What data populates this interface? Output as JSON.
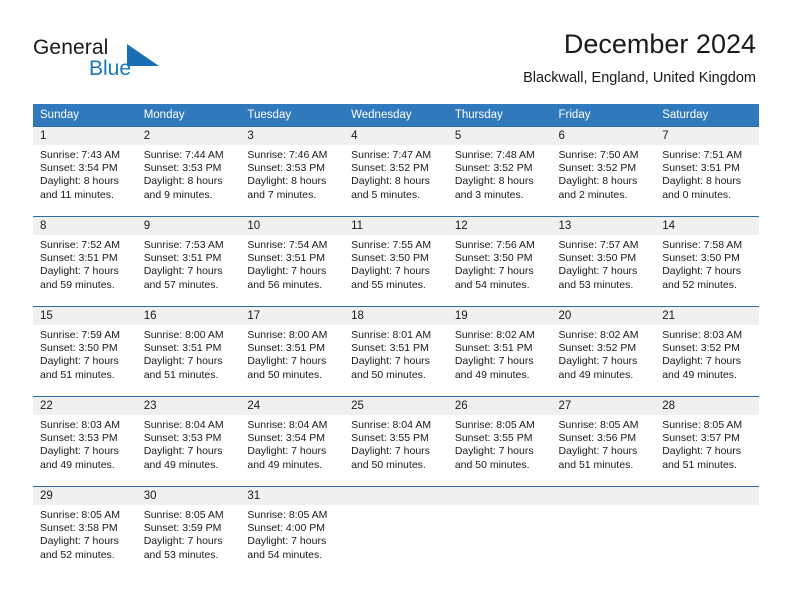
{
  "brand": {
    "name_part1": "General",
    "name_part2": "Blue",
    "logo_icon": "triangle-icon",
    "accent_color": "#1878be"
  },
  "header": {
    "title": "December 2024",
    "location": "Blackwall, England, United Kingdom"
  },
  "theme": {
    "header_bg": "#3179bd",
    "row_border": "#2e6da4",
    "daynum_bg": "#f0f0f0"
  },
  "weekday_headers": [
    "Sunday",
    "Monday",
    "Tuesday",
    "Wednesday",
    "Thursday",
    "Friday",
    "Saturday"
  ],
  "weeks": [
    [
      {
        "day": "1",
        "sunrise": "Sunrise: 7:43 AM",
        "sunset": "Sunset: 3:54 PM",
        "daylight_line1": "Daylight: 8 hours",
        "daylight_line2": "and 11 minutes."
      },
      {
        "day": "2",
        "sunrise": "Sunrise: 7:44 AM",
        "sunset": "Sunset: 3:53 PM",
        "daylight_line1": "Daylight: 8 hours",
        "daylight_line2": "and 9 minutes."
      },
      {
        "day": "3",
        "sunrise": "Sunrise: 7:46 AM",
        "sunset": "Sunset: 3:53 PM",
        "daylight_line1": "Daylight: 8 hours",
        "daylight_line2": "and 7 minutes."
      },
      {
        "day": "4",
        "sunrise": "Sunrise: 7:47 AM",
        "sunset": "Sunset: 3:52 PM",
        "daylight_line1": "Daylight: 8 hours",
        "daylight_line2": "and 5 minutes."
      },
      {
        "day": "5",
        "sunrise": "Sunrise: 7:48 AM",
        "sunset": "Sunset: 3:52 PM",
        "daylight_line1": "Daylight: 8 hours",
        "daylight_line2": "and 3 minutes."
      },
      {
        "day": "6",
        "sunrise": "Sunrise: 7:50 AM",
        "sunset": "Sunset: 3:52 PM",
        "daylight_line1": "Daylight: 8 hours",
        "daylight_line2": "and 2 minutes."
      },
      {
        "day": "7",
        "sunrise": "Sunrise: 7:51 AM",
        "sunset": "Sunset: 3:51 PM",
        "daylight_line1": "Daylight: 8 hours",
        "daylight_line2": "and 0 minutes."
      }
    ],
    [
      {
        "day": "8",
        "sunrise": "Sunrise: 7:52 AM",
        "sunset": "Sunset: 3:51 PM",
        "daylight_line1": "Daylight: 7 hours",
        "daylight_line2": "and 59 minutes."
      },
      {
        "day": "9",
        "sunrise": "Sunrise: 7:53 AM",
        "sunset": "Sunset: 3:51 PM",
        "daylight_line1": "Daylight: 7 hours",
        "daylight_line2": "and 57 minutes."
      },
      {
        "day": "10",
        "sunrise": "Sunrise: 7:54 AM",
        "sunset": "Sunset: 3:51 PM",
        "daylight_line1": "Daylight: 7 hours",
        "daylight_line2": "and 56 minutes."
      },
      {
        "day": "11",
        "sunrise": "Sunrise: 7:55 AM",
        "sunset": "Sunset: 3:50 PM",
        "daylight_line1": "Daylight: 7 hours",
        "daylight_line2": "and 55 minutes."
      },
      {
        "day": "12",
        "sunrise": "Sunrise: 7:56 AM",
        "sunset": "Sunset: 3:50 PM",
        "daylight_line1": "Daylight: 7 hours",
        "daylight_line2": "and 54 minutes."
      },
      {
        "day": "13",
        "sunrise": "Sunrise: 7:57 AM",
        "sunset": "Sunset: 3:50 PM",
        "daylight_line1": "Daylight: 7 hours",
        "daylight_line2": "and 53 minutes."
      },
      {
        "day": "14",
        "sunrise": "Sunrise: 7:58 AM",
        "sunset": "Sunset: 3:50 PM",
        "daylight_line1": "Daylight: 7 hours",
        "daylight_line2": "and 52 minutes."
      }
    ],
    [
      {
        "day": "15",
        "sunrise": "Sunrise: 7:59 AM",
        "sunset": "Sunset: 3:50 PM",
        "daylight_line1": "Daylight: 7 hours",
        "daylight_line2": "and 51 minutes."
      },
      {
        "day": "16",
        "sunrise": "Sunrise: 8:00 AM",
        "sunset": "Sunset: 3:51 PM",
        "daylight_line1": "Daylight: 7 hours",
        "daylight_line2": "and 51 minutes."
      },
      {
        "day": "17",
        "sunrise": "Sunrise: 8:00 AM",
        "sunset": "Sunset: 3:51 PM",
        "daylight_line1": "Daylight: 7 hours",
        "daylight_line2": "and 50 minutes."
      },
      {
        "day": "18",
        "sunrise": "Sunrise: 8:01 AM",
        "sunset": "Sunset: 3:51 PM",
        "daylight_line1": "Daylight: 7 hours",
        "daylight_line2": "and 50 minutes."
      },
      {
        "day": "19",
        "sunrise": "Sunrise: 8:02 AM",
        "sunset": "Sunset: 3:51 PM",
        "daylight_line1": "Daylight: 7 hours",
        "daylight_line2": "and 49 minutes."
      },
      {
        "day": "20",
        "sunrise": "Sunrise: 8:02 AM",
        "sunset": "Sunset: 3:52 PM",
        "daylight_line1": "Daylight: 7 hours",
        "daylight_line2": "and 49 minutes."
      },
      {
        "day": "21",
        "sunrise": "Sunrise: 8:03 AM",
        "sunset": "Sunset: 3:52 PM",
        "daylight_line1": "Daylight: 7 hours",
        "daylight_line2": "and 49 minutes."
      }
    ],
    [
      {
        "day": "22",
        "sunrise": "Sunrise: 8:03 AM",
        "sunset": "Sunset: 3:53 PM",
        "daylight_line1": "Daylight: 7 hours",
        "daylight_line2": "and 49 minutes."
      },
      {
        "day": "23",
        "sunrise": "Sunrise: 8:04 AM",
        "sunset": "Sunset: 3:53 PM",
        "daylight_line1": "Daylight: 7 hours",
        "daylight_line2": "and 49 minutes."
      },
      {
        "day": "24",
        "sunrise": "Sunrise: 8:04 AM",
        "sunset": "Sunset: 3:54 PM",
        "daylight_line1": "Daylight: 7 hours",
        "daylight_line2": "and 49 minutes."
      },
      {
        "day": "25",
        "sunrise": "Sunrise: 8:04 AM",
        "sunset": "Sunset: 3:55 PM",
        "daylight_line1": "Daylight: 7 hours",
        "daylight_line2": "and 50 minutes."
      },
      {
        "day": "26",
        "sunrise": "Sunrise: 8:05 AM",
        "sunset": "Sunset: 3:55 PM",
        "daylight_line1": "Daylight: 7 hours",
        "daylight_line2": "and 50 minutes."
      },
      {
        "day": "27",
        "sunrise": "Sunrise: 8:05 AM",
        "sunset": "Sunset: 3:56 PM",
        "daylight_line1": "Daylight: 7 hours",
        "daylight_line2": "and 51 minutes."
      },
      {
        "day": "28",
        "sunrise": "Sunrise: 8:05 AM",
        "sunset": "Sunset: 3:57 PM",
        "daylight_line1": "Daylight: 7 hours",
        "daylight_line2": "and 51 minutes."
      }
    ],
    [
      {
        "day": "29",
        "sunrise": "Sunrise: 8:05 AM",
        "sunset": "Sunset: 3:58 PM",
        "daylight_line1": "Daylight: 7 hours",
        "daylight_line2": "and 52 minutes."
      },
      {
        "day": "30",
        "sunrise": "Sunrise: 8:05 AM",
        "sunset": "Sunset: 3:59 PM",
        "daylight_line1": "Daylight: 7 hours",
        "daylight_line2": "and 53 minutes."
      },
      {
        "day": "31",
        "sunrise": "Sunrise: 8:05 AM",
        "sunset": "Sunset: 4:00 PM",
        "daylight_line1": "Daylight: 7 hours",
        "daylight_line2": "and 54 minutes."
      },
      {
        "day": "",
        "sunrise": "",
        "sunset": "",
        "daylight_line1": "",
        "daylight_line2": ""
      },
      {
        "day": "",
        "sunrise": "",
        "sunset": "",
        "daylight_line1": "",
        "daylight_line2": ""
      },
      {
        "day": "",
        "sunrise": "",
        "sunset": "",
        "daylight_line1": "",
        "daylight_line2": ""
      },
      {
        "day": "",
        "sunrise": "",
        "sunset": "",
        "daylight_line1": "",
        "daylight_line2": ""
      }
    ]
  ]
}
